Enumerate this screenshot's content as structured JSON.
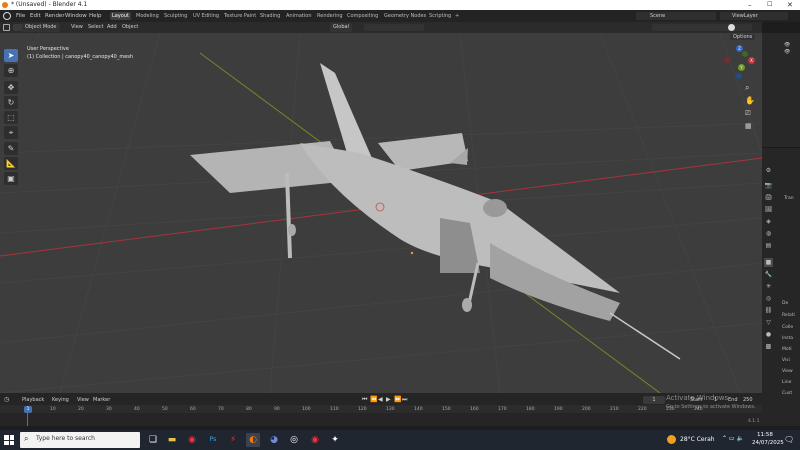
{
  "titlebar": {
    "title": "* (Unsaved) - Blender 4.1"
  },
  "menu": [
    "File",
    "Edit",
    "Render",
    "Window",
    "Help"
  ],
  "workspaces": [
    "Layout",
    "Modeling",
    "Sculpting",
    "UV Editing",
    "Texture Paint",
    "Shading",
    "Animation",
    "Rendering",
    "Compositing",
    "Geometry Nodes",
    "Scripting"
  ],
  "workspace_add": "+",
  "scene": {
    "label": "Scene",
    "viewlayer": "ViewLayer"
  },
  "header": {
    "mode": "Object Mode",
    "view": "View",
    "select": "Select",
    "add": "Add",
    "object": "Object",
    "orientation": "Global",
    "options": "Options"
  },
  "viewport": {
    "perspective": "User Perspective",
    "collection": "(1) Collection | canopy40_canopy40_mesh"
  },
  "gizmo": {
    "x": "X",
    "y": "Y",
    "z": "Z"
  },
  "right_panel": {
    "tab_label": "Tran",
    "sections": [
      "De",
      "Relati",
      "Colle",
      "Insta",
      "Moti",
      "Visi",
      "View",
      "Line",
      "Cust"
    ]
  },
  "timeline": {
    "playback": "Playback",
    "keying": "Keying",
    "view": "View",
    "marker": "Marker",
    "current_frame": "1",
    "start_label": "Start",
    "start": "1",
    "end_label": "End",
    "end": "250",
    "ticks": [
      "10",
      "20",
      "30",
      "40",
      "50",
      "60",
      "70",
      "80",
      "90",
      "100",
      "110",
      "120",
      "130",
      "140",
      "150",
      "160",
      "170",
      "180",
      "190",
      "200",
      "210",
      "220",
      "230",
      "240"
    ],
    "current_marker": "1",
    "version": "4.1.1"
  },
  "watermark": {
    "title": "Activate Windows",
    "sub": "Go to Settings to activate Windows."
  },
  "taskbar": {
    "search_placeholder": "Type here to search",
    "weather": "28°C  Cerah",
    "time": "11:58",
    "date": "24/07/2025"
  },
  "colors": {
    "accent": "#4772b3",
    "x_axis": "#a8343a",
    "y_axis": "#6e8a2a",
    "viewport_bg": "#3d3d3d"
  }
}
